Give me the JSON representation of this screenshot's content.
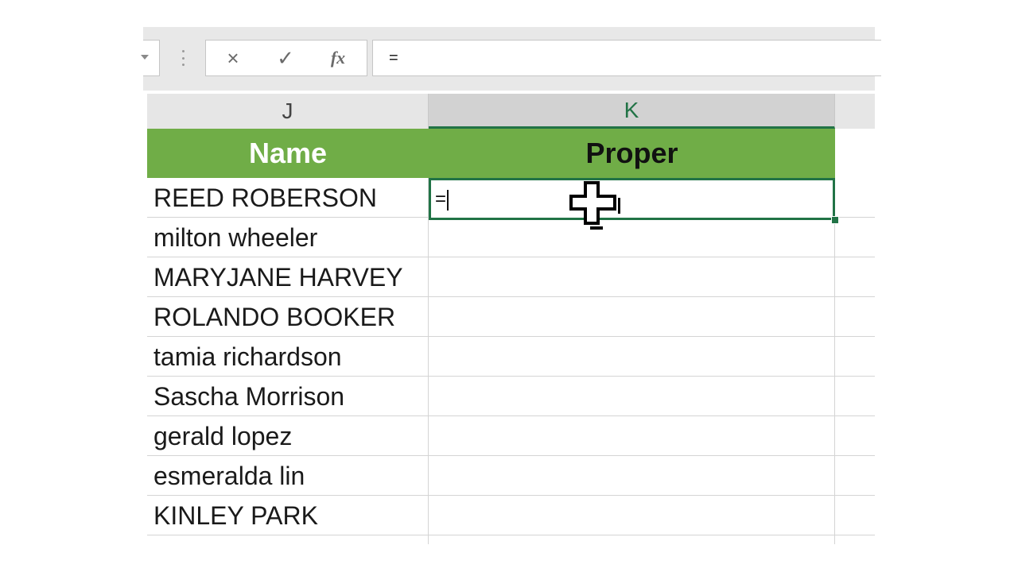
{
  "formula_bar": {
    "cancel_icon": "×",
    "enter_icon": "✓",
    "insert_function_label": "fx",
    "formula_text": "="
  },
  "columns": {
    "j": "J",
    "k": "K"
  },
  "table": {
    "headers": {
      "name": "Name",
      "proper": "Proper"
    },
    "header_colors": {
      "fill": "#70ad47",
      "name_text": "#ffffff",
      "proper_text": "#111111"
    },
    "names": [
      "REED ROBERSON",
      "milton wheeler",
      "MARYJANE HARVEY",
      "ROLANDO BOOKER",
      "tamia richardson",
      "Sascha Morrison",
      "gerald lopez",
      "esmeralda lin",
      "KINLEY PARK"
    ]
  },
  "active_cell": {
    "value": "=",
    "border_color": "#217346"
  },
  "icons": {
    "cursor": "cell-select-cross-cursor-icon",
    "name_box_dropdown": "chevron-down-icon"
  }
}
